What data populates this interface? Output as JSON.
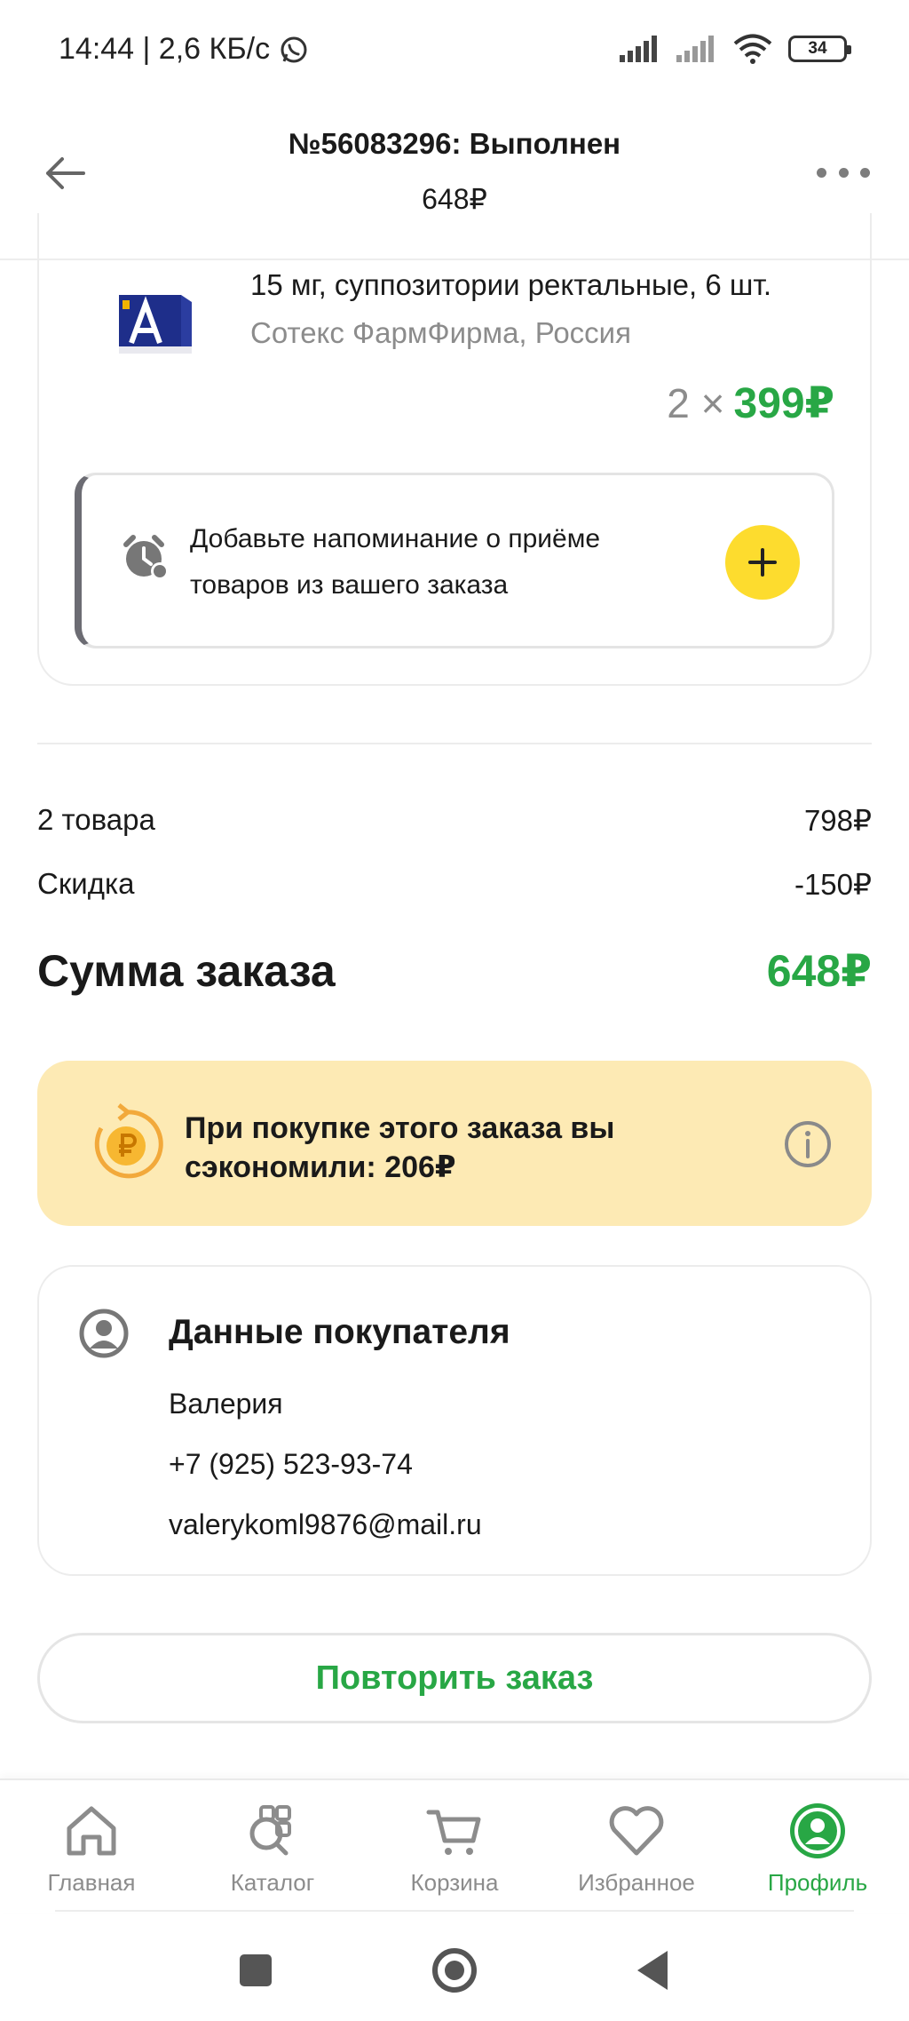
{
  "status_bar": {
    "time": "14:44 | 2,6 КБ/с",
    "battery": "34"
  },
  "header": {
    "title": "№56083296: Выполнен",
    "subtitle": "648₽"
  },
  "product": {
    "description": "15 мг, суппозитории ректальные, 6 шт.",
    "manufacturer": "Сотекс ФармФирма, Россия",
    "quantity": "2 ×",
    "price": "399₽"
  },
  "reminder": {
    "text": "Добавьте напоминание о приёме товаров из вашего заказа"
  },
  "summary": {
    "items_label": "2 товара",
    "items_value": "798₽",
    "discount_label": "Скидка",
    "discount_value": "-150₽",
    "total_label": "Сумма заказа",
    "total_value": "648₽"
  },
  "savings": {
    "text": "При покупке этого заказа вы сэкономили: 206₽"
  },
  "customer": {
    "title": "Данные покупателя",
    "name": "Валерия",
    "phone": "+7 (925) 523-93-74",
    "email": "valerykoml9876@mail.ru"
  },
  "actions": {
    "repeat_label": "Повторить заказ"
  },
  "bottom_nav": {
    "items": [
      {
        "label": "Главная",
        "icon": "home-icon"
      },
      {
        "label": "Каталог",
        "icon": "catalog-icon"
      },
      {
        "label": "Корзина",
        "icon": "cart-icon"
      },
      {
        "label": "Избранное",
        "icon": "heart-icon"
      },
      {
        "label": "Профиль",
        "icon": "profile-icon",
        "active": true
      }
    ]
  },
  "colors": {
    "accent": "#28a745",
    "savings_bg": "#fdeab4",
    "add_button": "#fddc2e"
  }
}
